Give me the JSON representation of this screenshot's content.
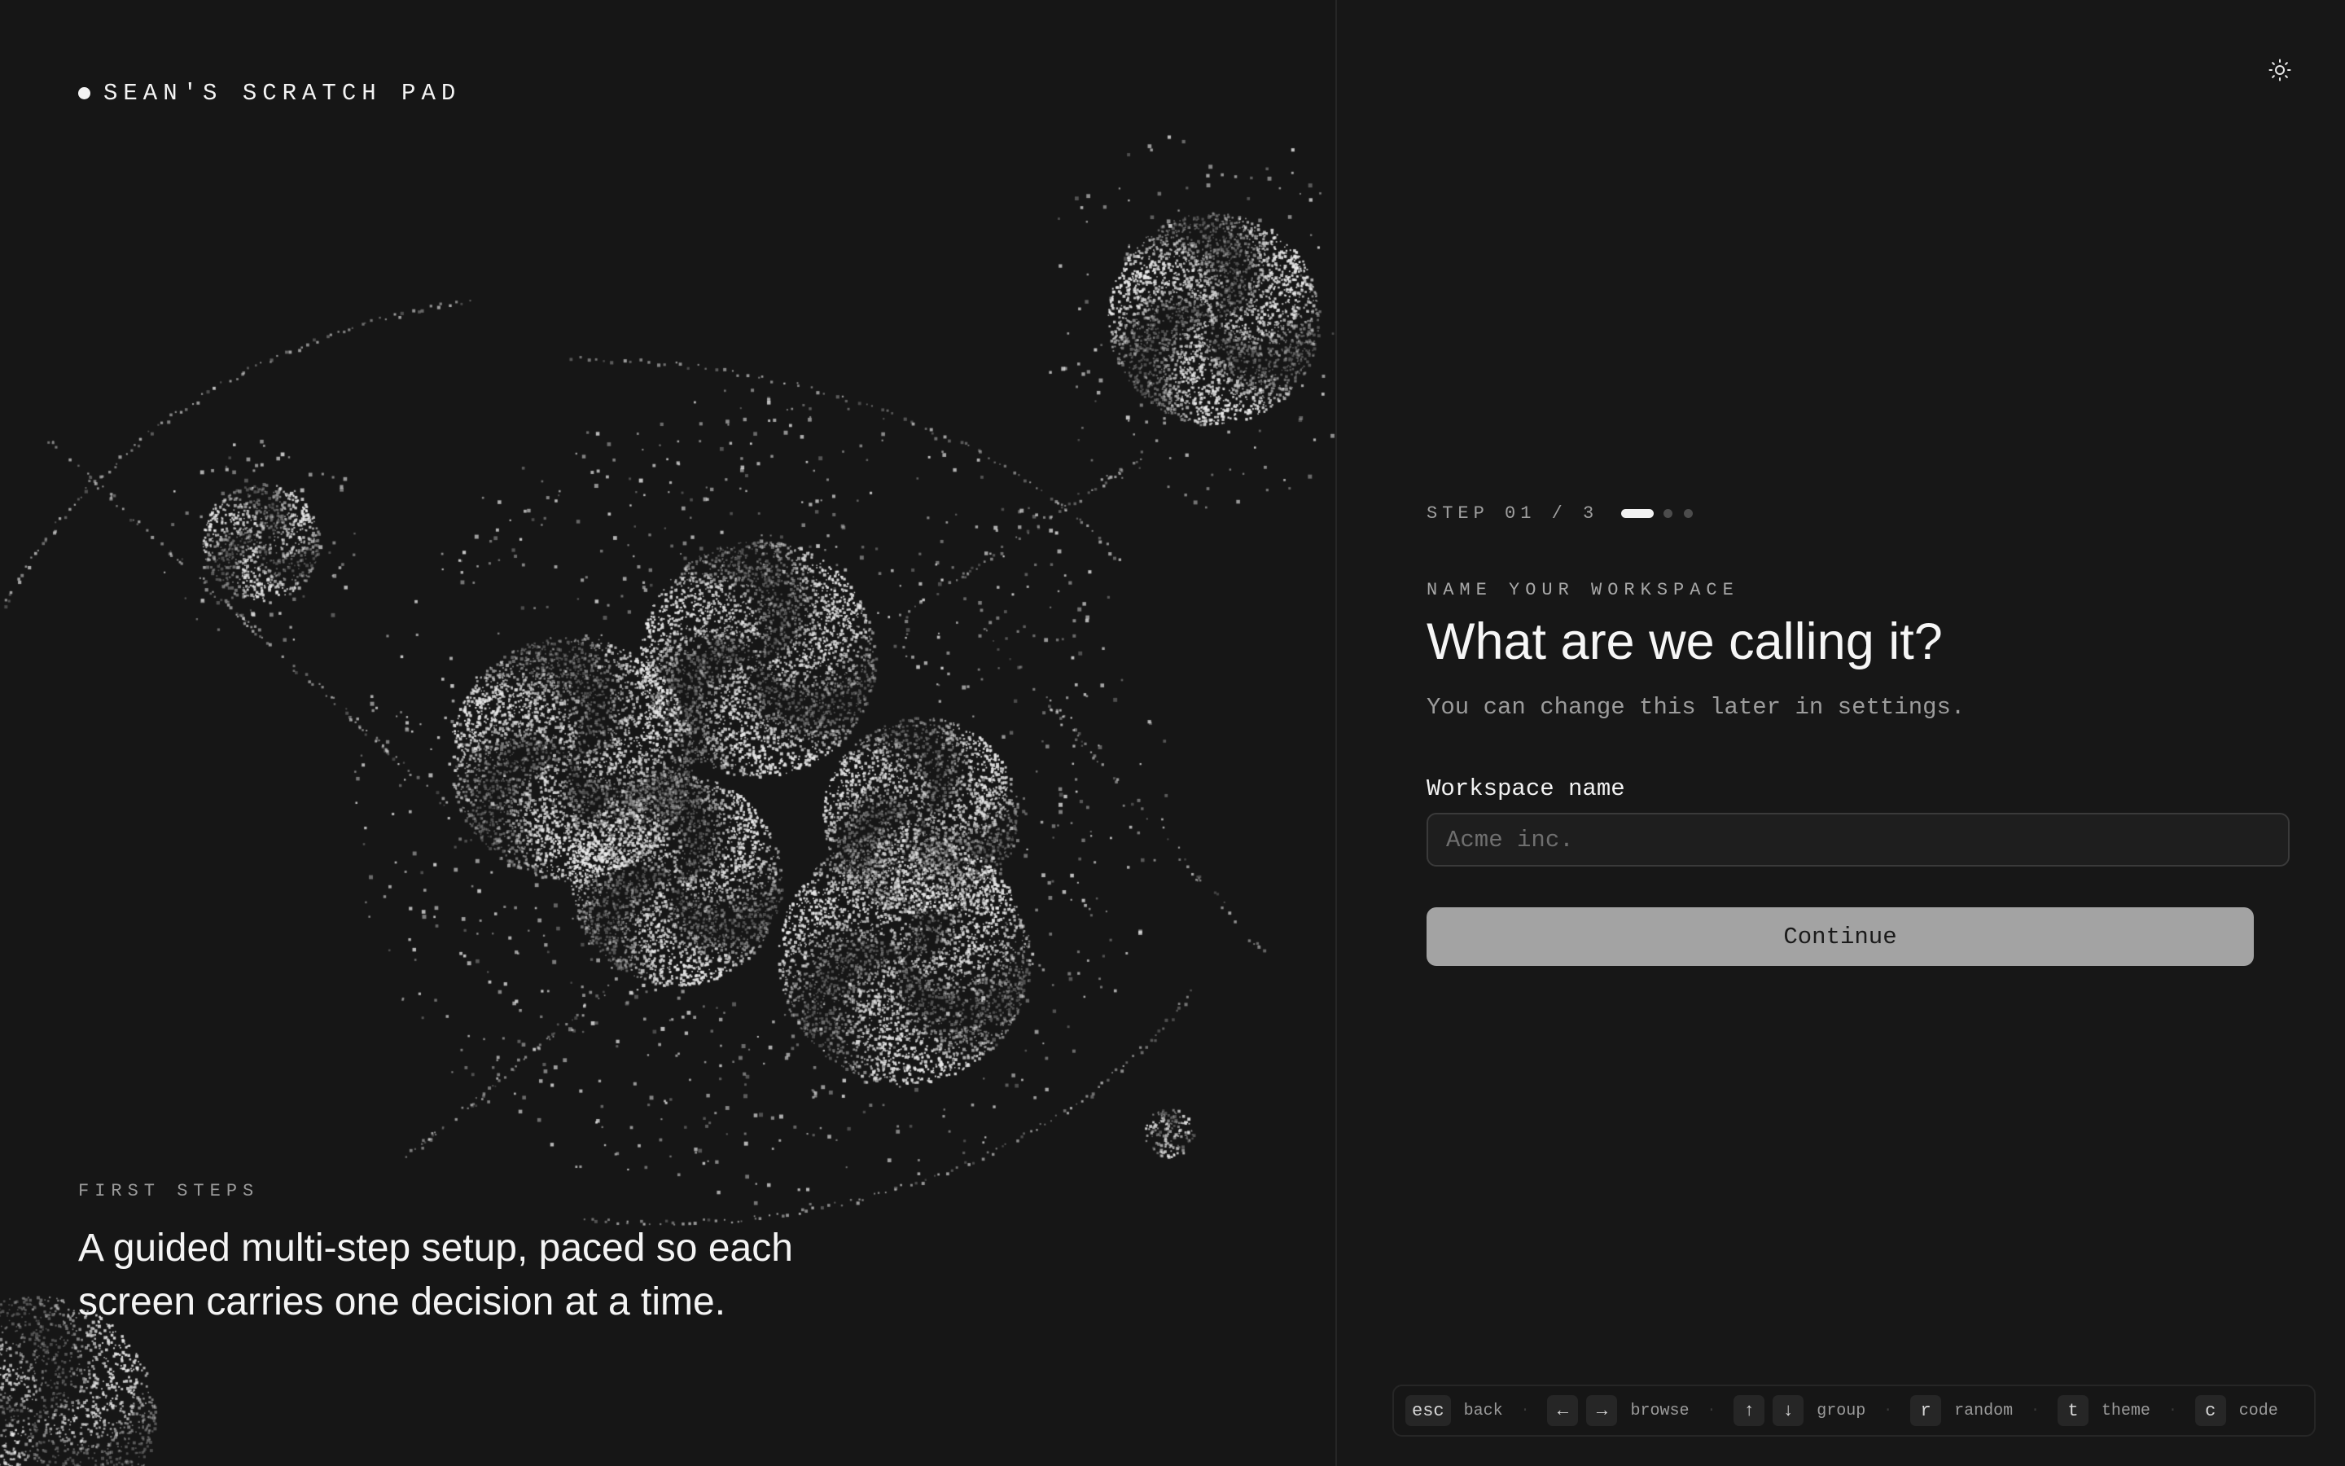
{
  "brand": {
    "name": "SEAN'S SCRATCH PAD"
  },
  "hero": {
    "eyebrow": "FIRST STEPS",
    "description": "A guided multi-step setup, paced so each screen carries one decision at a time."
  },
  "theme_toggle": {
    "icon": "sun-icon"
  },
  "step": {
    "label": "STEP 01 / 3",
    "current": 1,
    "total": 3
  },
  "form": {
    "eyebrow": "NAME YOUR WORKSPACE",
    "heading": "What are we calling it?",
    "subtext": "You can change this later in settings.",
    "field_label": "Workspace name",
    "field_placeholder": "Acme inc.",
    "field_value": "",
    "continue_label": "Continue"
  },
  "shortcuts": [
    {
      "keys": [
        "esc"
      ],
      "label": "back"
    },
    {
      "keys": [
        "←",
        "→"
      ],
      "label": "browse"
    },
    {
      "keys": [
        "↑",
        "↓"
      ],
      "label": "group"
    },
    {
      "keys": [
        "r"
      ],
      "label": "random"
    },
    {
      "keys": [
        "t"
      ],
      "label": "theme"
    },
    {
      "keys": [
        "c"
      ],
      "label": "code"
    }
  ],
  "colors": {
    "background": "#161616",
    "text": "#f4f4f4",
    "muted": "#9a9a9a",
    "button": "#a3a3a3"
  }
}
